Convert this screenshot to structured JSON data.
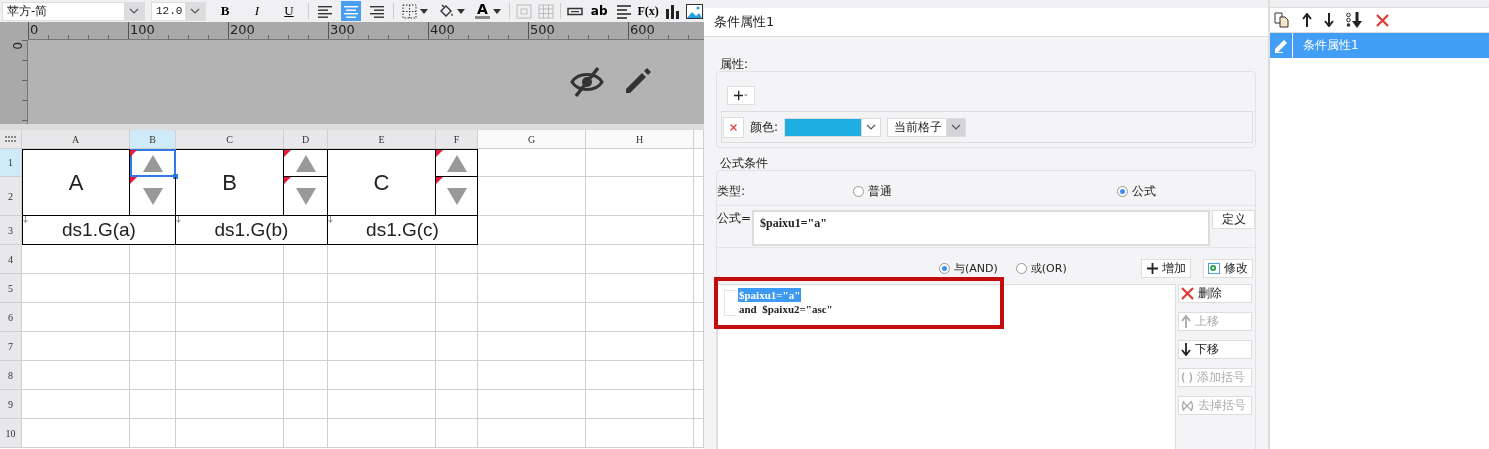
{
  "toolbar": {
    "font": "苹方-简",
    "size": "12.0",
    "format_buttons": [
      "B",
      "I",
      "U"
    ],
    "align": [
      {
        "selected": false
      },
      {
        "selected": true
      },
      {
        "selected": false
      }
    ],
    "font_color_letter": "A",
    "text_tools": [
      "ab",
      "F(x)"
    ]
  },
  "ruler": {
    "h_labels": [
      "0",
      "100",
      "200",
      "300",
      "400",
      "500",
      "600"
    ],
    "v_labels": [
      "0"
    ]
  },
  "sheet": {
    "columns": [
      {
        "label": "A",
        "selected": false
      },
      {
        "label": "B",
        "selected": true
      },
      {
        "label": "C",
        "selected": false
      },
      {
        "label": "D",
        "selected": false
      },
      {
        "label": "E",
        "selected": false
      },
      {
        "label": "F",
        "selected": false
      },
      {
        "label": "G",
        "selected": false
      },
      {
        "label": "H",
        "selected": false
      }
    ],
    "rows": [
      {
        "label": "1",
        "selected": true
      },
      {
        "label": "2",
        "selected": false
      },
      {
        "label": "3",
        "selected": false
      },
      {
        "label": "4",
        "selected": false
      },
      {
        "label": "5",
        "selected": false
      },
      {
        "label": "6",
        "selected": false
      },
      {
        "label": "7",
        "selected": false
      },
      {
        "label": "8",
        "selected": false
      },
      {
        "label": "9",
        "selected": false
      },
      {
        "label": "10",
        "selected": false
      }
    ],
    "cells": [
      {
        "kind": "text",
        "text": "A",
        "selected": false,
        "flagged": false
      },
      {
        "kind": "sort-up",
        "selected": true,
        "flagged": true
      },
      {
        "kind": "text",
        "text": "B",
        "selected": false,
        "flagged": false
      },
      {
        "kind": "sort-up",
        "selected": false,
        "flagged": true
      },
      {
        "kind": "text",
        "text": "C",
        "selected": false,
        "flagged": false
      },
      {
        "kind": "sort-up",
        "selected": false,
        "flagged": true
      },
      {
        "kind": "sort-down",
        "selected": false,
        "flagged": true
      },
      {
        "kind": "sort-down",
        "selected": false,
        "flagged": true
      },
      {
        "kind": "sort-down",
        "selected": false,
        "flagged": true
      },
      {
        "kind": "formula",
        "text": "ds1.G(a)",
        "selected": false,
        "flagged": false
      },
      {
        "kind": "formula",
        "text": "ds1.G(b)",
        "selected": false,
        "flagged": false
      },
      {
        "kind": "formula",
        "text": "ds1.G(c)",
        "selected": false,
        "flagged": false
      }
    ]
  },
  "dialog": {
    "title": "条件属性1",
    "attributes": {
      "label": "属性:",
      "rows": [
        {
          "label": "颜色:",
          "color": "#1faee3",
          "scope": "当前格子"
        }
      ]
    },
    "formula_condition": {
      "label": "公式条件",
      "type_label": "类型:",
      "types": [
        {
          "label": "普通",
          "selected": false
        },
        {
          "label": "公式",
          "selected": true
        }
      ],
      "formula_label": "公式=",
      "formula": "$paixu1=\"a\"",
      "define_button": "定义",
      "logic": [
        {
          "label": "与(AND)",
          "selected": true
        },
        {
          "label": "或(OR)",
          "selected": false
        }
      ],
      "add_button": "增加",
      "modify_button": "修改",
      "conditions": [
        {
          "text": "$paixu1=\"a\"",
          "selected": true
        },
        {
          "text": "and  $paixu2=\"asc\"",
          "selected": false
        }
      ],
      "side_buttons": [
        {
          "label": "删除",
          "disabled": false
        },
        {
          "label": "上移",
          "disabled": true
        },
        {
          "label": "下移",
          "disabled": false
        },
        {
          "label": "添加括号",
          "disabled": true
        },
        {
          "label": "去掉括号",
          "disabled": true
        }
      ]
    },
    "annotation": {
      "kind": "highlight-box"
    }
  },
  "right_panel": {
    "items": [
      {
        "label": "条件属性1",
        "selected": true
      }
    ]
  }
}
